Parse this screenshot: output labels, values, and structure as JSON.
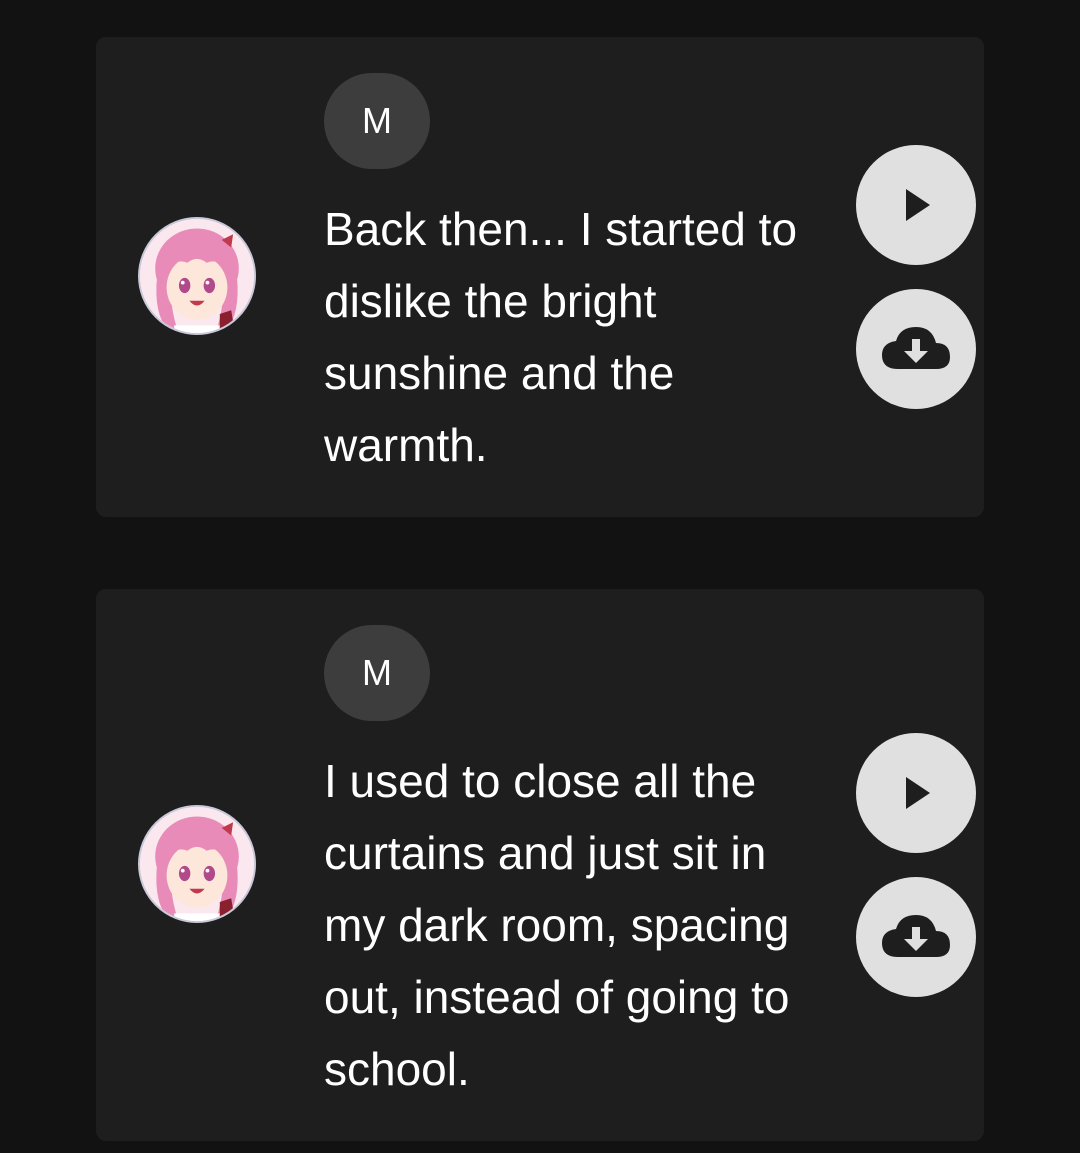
{
  "messages": [
    {
      "speaker_initial": "M",
      "text": "Back then... I started to dislike the bright sunshine and the warmth.",
      "play_icon": "play-icon",
      "download_icon": "cloud-download-icon"
    },
    {
      "speaker_initial": "M",
      "text": "I used to close all the curtains and just sit in my dark room, spacing out, instead of going to school.",
      "play_icon": "play-icon",
      "download_icon": "cloud-download-icon"
    }
  ],
  "colors": {
    "background": "#121212",
    "card": "#1e1e1e",
    "chip": "#3d3d3d",
    "button": "#e0e0e0",
    "icon": "#1e1e1e",
    "avatar_hair": "#e88bb8"
  }
}
